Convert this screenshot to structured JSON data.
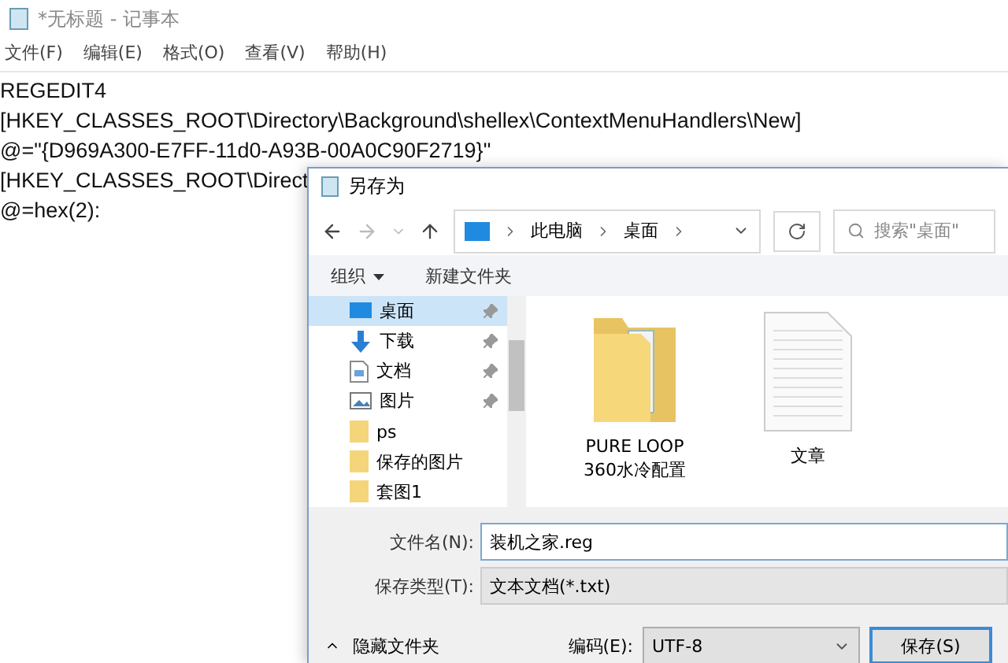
{
  "notepad": {
    "title": "*无标题 - 记事本",
    "menu": [
      "文件(F)",
      "编辑(E)",
      "格式(O)",
      "查看(V)",
      "帮助(H)"
    ],
    "lines": [
      "REGEDIT4",
      "[HKEY_CLASSES_ROOT\\Directory\\Background\\shellex\\ContextMenuHandlers\\New]",
      "@=\"{D969A300-E7FF-11d0-A93B-00A0C90F2719}\"",
      "[HKEY_CLASSES_ROOT\\Direct",
      "@=hex(2):"
    ]
  },
  "dialog": {
    "title": "另存为",
    "breadcrumb": [
      "此电脑",
      "桌面"
    ],
    "search": {
      "placeholder": "搜索\"桌面\""
    },
    "toolbar": [
      "组织",
      "新建文件夹"
    ],
    "sidebar": [
      {
        "label": "桌面",
        "kind": "desktop",
        "pinned": true,
        "selected": true
      },
      {
        "label": "下载",
        "kind": "download",
        "pinned": true,
        "selected": false
      },
      {
        "label": "文档",
        "kind": "document",
        "pinned": true,
        "selected": false
      },
      {
        "label": "图片",
        "kind": "picture",
        "pinned": true,
        "selected": false
      },
      {
        "label": "ps",
        "kind": "folder",
        "pinned": false,
        "selected": false
      },
      {
        "label": "保存的图片",
        "kind": "folder",
        "pinned": false,
        "selected": false
      },
      {
        "label": "套图1",
        "kind": "folder",
        "pinned": false,
        "selected": false
      }
    ],
    "files": [
      {
        "name": "PURE LOOP\n360水冷配置",
        "kind": "folder"
      },
      {
        "name": "文章",
        "kind": "text"
      }
    ],
    "filename": {
      "label": "文件名(N):",
      "value": "装机之家.reg"
    },
    "filetype": {
      "label": "保存类型(T):",
      "value": "文本文档(*.txt)"
    },
    "hide_folders": "隐藏文件夹",
    "encoding": {
      "label": "编码(E):",
      "value": "UTF-8"
    },
    "save_button": "保存(S)"
  }
}
